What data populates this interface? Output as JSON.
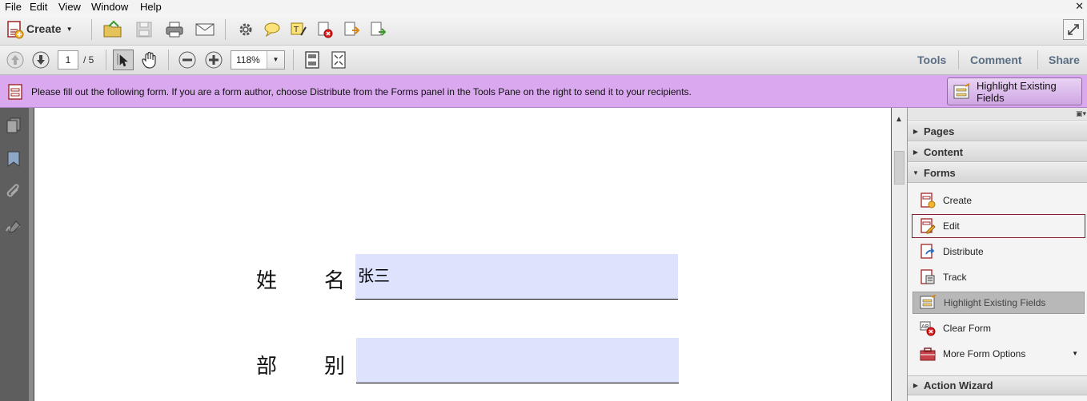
{
  "menu": [
    "File",
    "Edit",
    "View",
    "Window",
    "Help"
  ],
  "menu_mnemonics": [
    "F",
    "E",
    "V",
    "W",
    "H"
  ],
  "toolbar": {
    "create_label": "Create",
    "page_current": "1",
    "page_total": "/ 5",
    "zoom": "118%"
  },
  "right_tabs": [
    "Tools",
    "Comment",
    "Share"
  ],
  "formbar": {
    "message": "Please fill out the following form. If you are a form author, choose Distribute from the Forms panel in the Tools Pane on the right to send it to your recipients.",
    "highlight_button": "Highlight Existing Fields"
  },
  "document": {
    "fields": [
      {
        "label_chars": [
          "姓",
          "名"
        ],
        "value": "张三"
      },
      {
        "label_chars": [
          "部",
          "别"
        ],
        "value": ""
      }
    ]
  },
  "pane": {
    "sections": [
      {
        "label": "Pages",
        "expanded": false
      },
      {
        "label": "Content",
        "expanded": false
      },
      {
        "label": "Forms",
        "expanded": true
      },
      {
        "label": "Action Wizard",
        "expanded": false
      }
    ],
    "forms_items": [
      {
        "label": "Create"
      },
      {
        "label": "Edit"
      },
      {
        "label": "Distribute"
      },
      {
        "label": "Track"
      },
      {
        "label": "Highlight Existing Fields"
      },
      {
        "label": "Clear Form"
      },
      {
        "label": "More Form Options"
      }
    ]
  },
  "colors": {
    "form_bar": "#d9a8ee",
    "field_fill": "#dde3fd",
    "tab_text": "#5a6d82",
    "focus_outline": "#8a1f2c"
  }
}
